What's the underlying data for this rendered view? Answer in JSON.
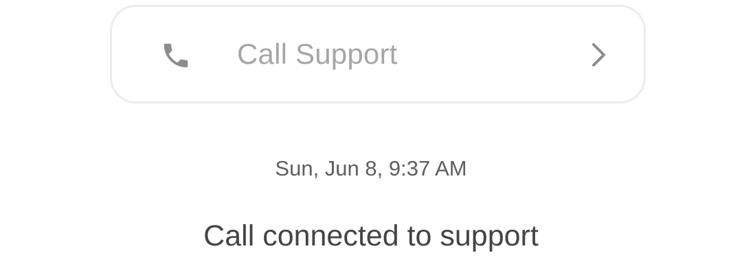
{
  "support_card": {
    "label": "Call Support",
    "icon": "phone-icon",
    "chevron": "chevron-right-icon"
  },
  "event": {
    "timestamp": "Sun, Jun 8, 9:37 AM",
    "message": "Call connected to support"
  },
  "colors": {
    "card_border": "#ececec",
    "label": "#a6a6a6",
    "icon": "#8c8c8c",
    "timestamp": "#5e5e5e",
    "message": "#444444"
  }
}
